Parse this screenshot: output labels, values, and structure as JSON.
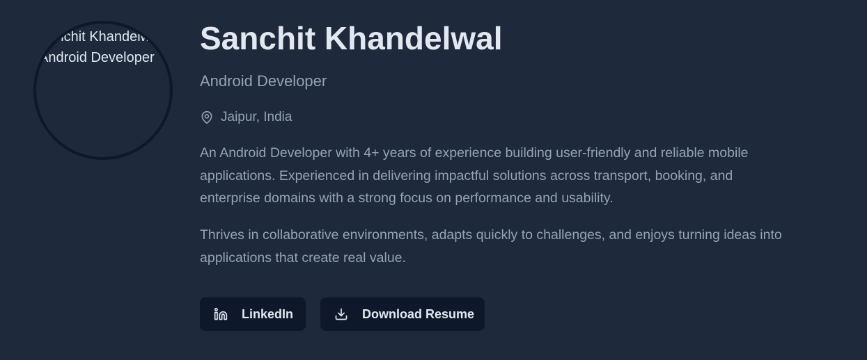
{
  "profile": {
    "avatar_alt": "Sanchit Khandelwal - Android Developer",
    "name": "Sanchit Khandelwal",
    "role": "Android Developer",
    "location": "Jaipur, India",
    "bio_1": "An Android Developer with 4+ years of experience building user-friendly and reliable mobile applications. Experienced in delivering impactful solutions across transport, booking, and enterprise domains with a strong focus on performance and usability.",
    "bio_2": "Thrives in collaborative environments, adapts quickly to challenges, and enjoys turning ideas into applications that create real value."
  },
  "actions": {
    "linkedin_label": "LinkedIn",
    "linkedin_icon": "linkedin-icon",
    "resume_label": "Download Resume",
    "resume_icon": "download-icon"
  },
  "colors": {
    "background": "#1e293b",
    "button_bg": "#0f172a",
    "heading": "#e2e8f0",
    "muted_text": "#94a3b8"
  }
}
